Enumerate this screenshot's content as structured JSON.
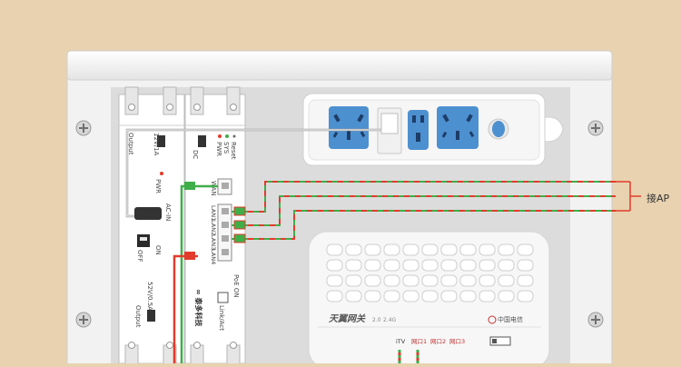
{
  "colors": {
    "background": "#e8d2b0",
    "outlet_blue": "#4d90d0",
    "cable_red": "#e23b2c",
    "cable_green": "#3fae49"
  },
  "annotation": {
    "connect_ap": "接AP"
  },
  "power_module": {
    "output_left": "Output",
    "rating_12v": "12V/1A",
    "pwr": "PWR",
    "ac_in": "AC-IN",
    "off": "OFF",
    "on": "ON",
    "rating_52v": "52V/0.5A",
    "output_bottom": "Output"
  },
  "switch_module": {
    "dc": "DC",
    "reset": "Reset",
    "sys": "SYS",
    "pwr": "PWR",
    "wan": "WAN",
    "lan_ports": [
      "LAN1",
      "LAN2",
      "LAN3",
      "LAN4"
    ],
    "poe_on": "PoE ON",
    "link_act": "Link/Act",
    "brand": "∞ 泰多科技"
  },
  "router": {
    "brand": "天翼网关",
    "model": "2.0",
    "band": "2.4G",
    "carrier": "中国电信",
    "ports": [
      "iTV",
      "网口1",
      "网口2",
      "网口3"
    ]
  }
}
